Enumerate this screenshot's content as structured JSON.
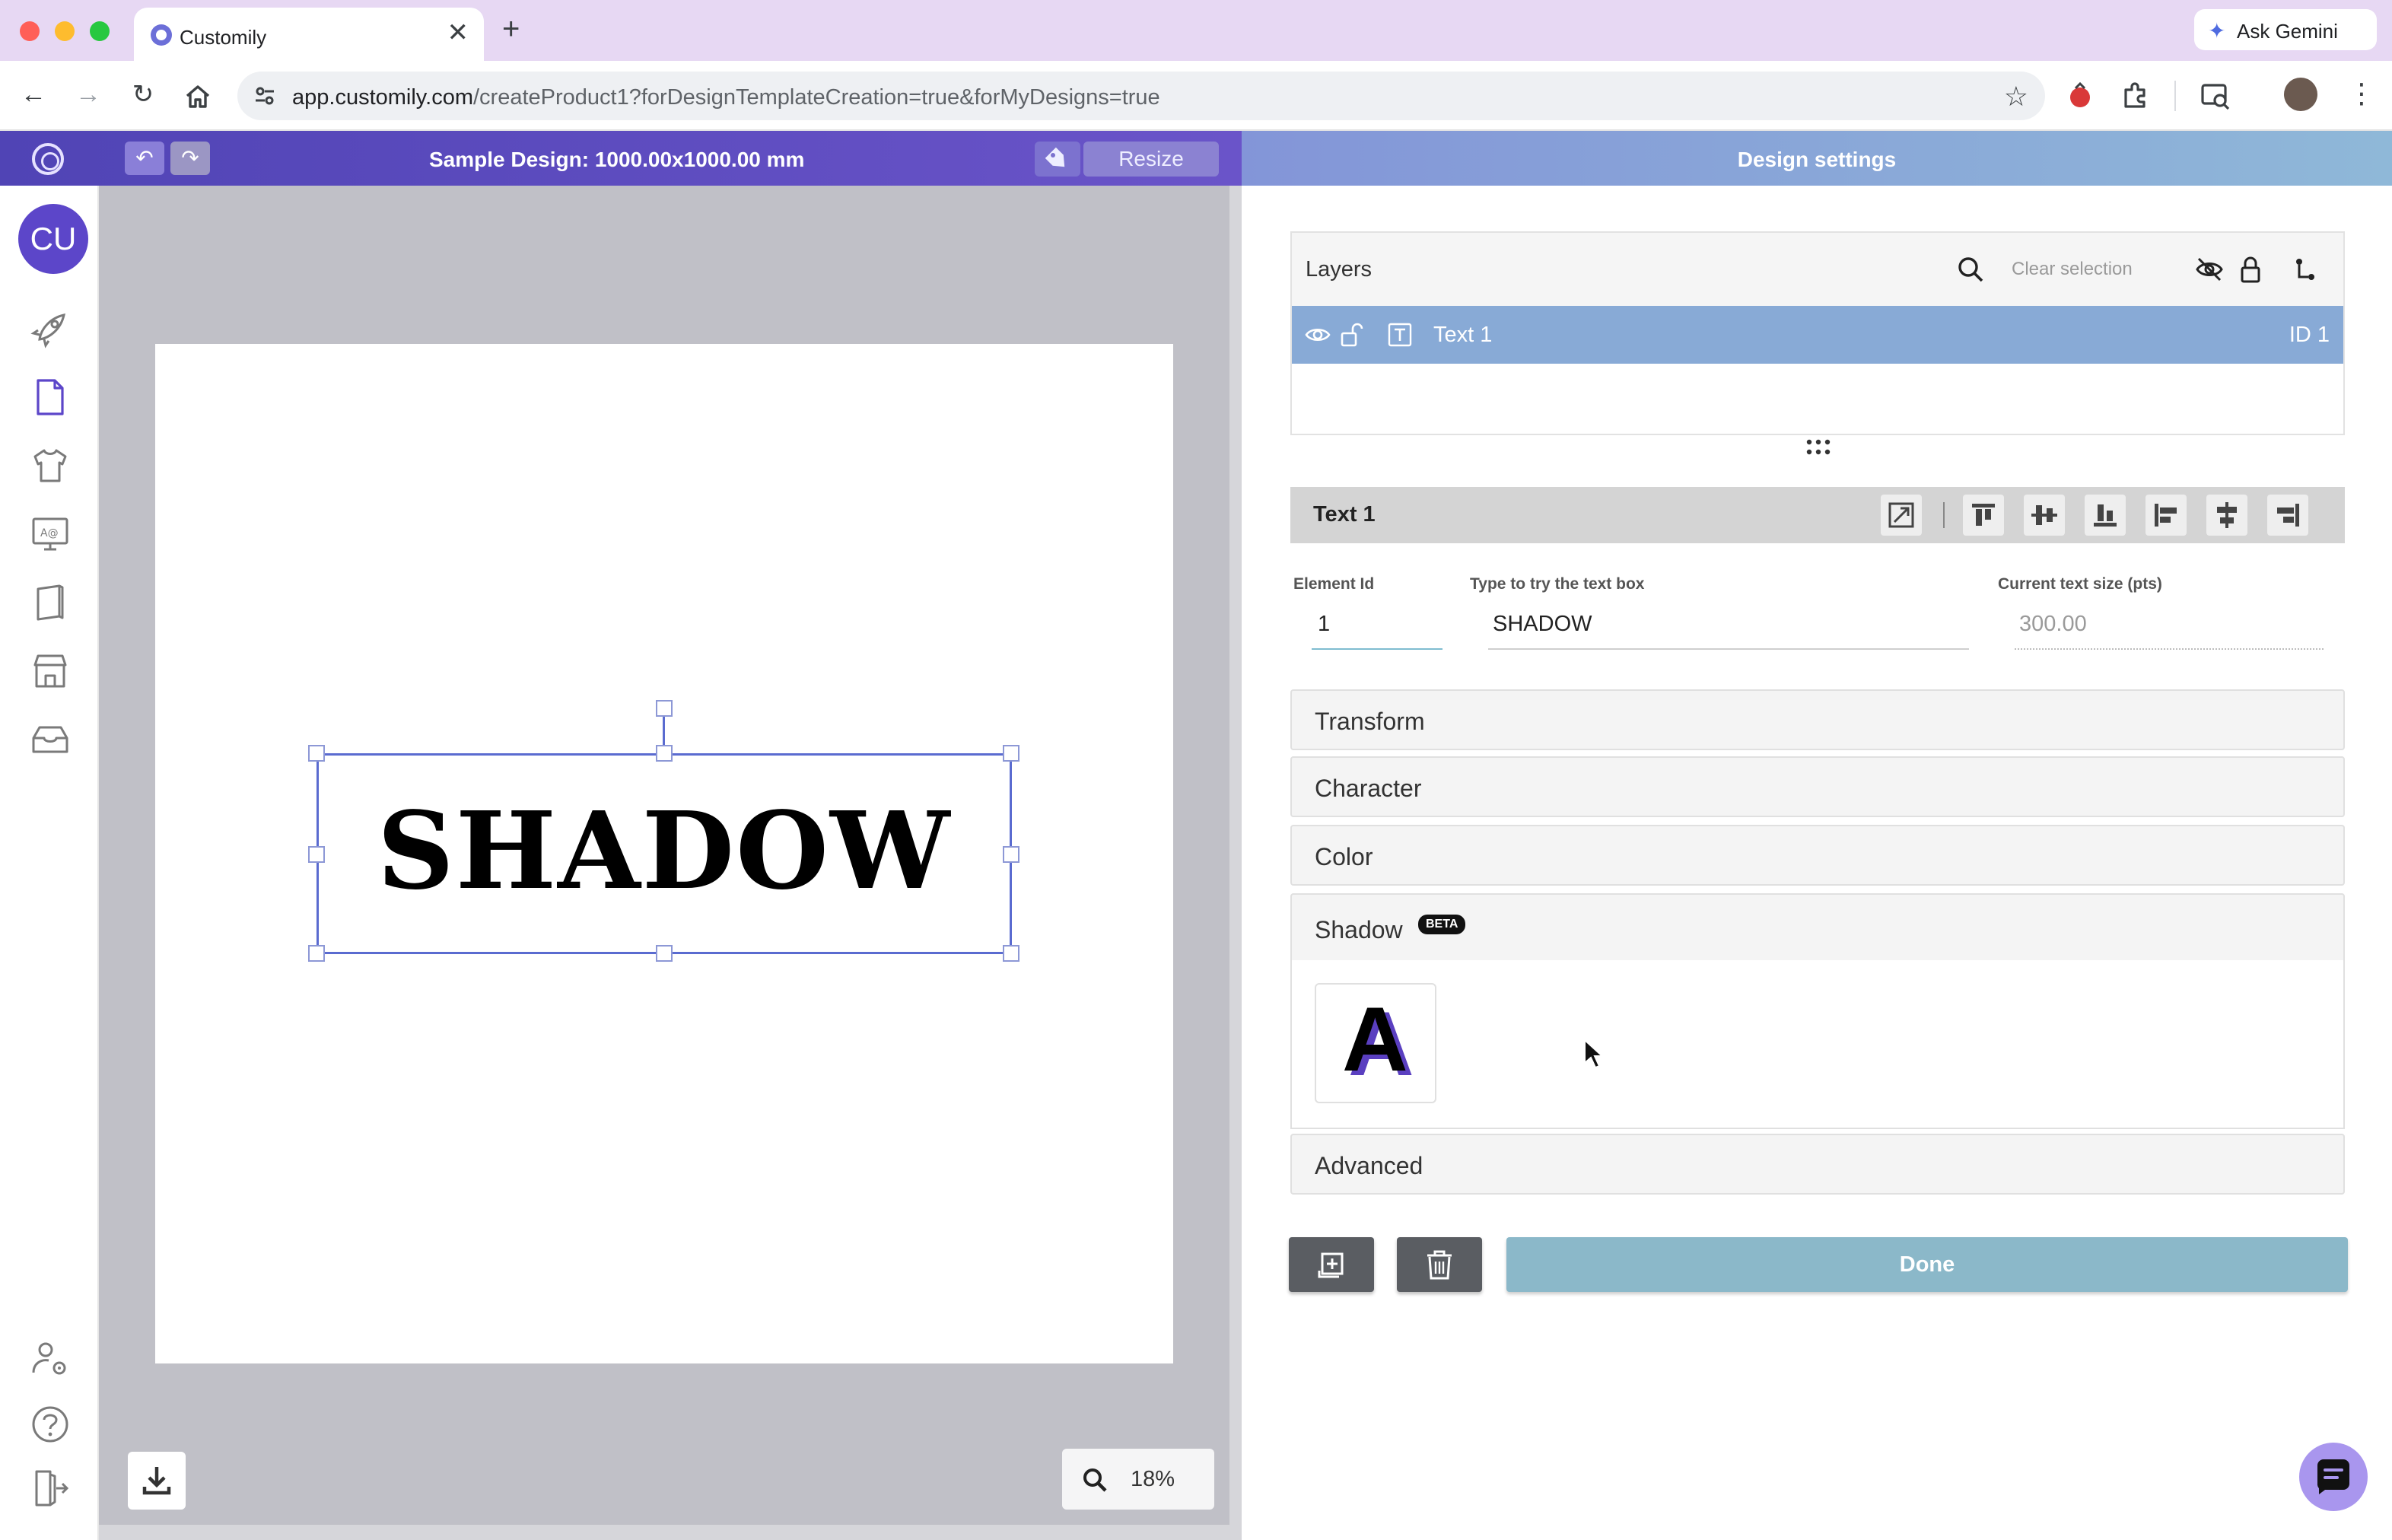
{
  "browser": {
    "tab_title": "Customily",
    "tab_close": "✕",
    "new_tab": "+",
    "url_host": "app.customily.com",
    "url_path": "/createProduct1?forDesignTemplateCreation=true&forMyDesigns=true",
    "ask_gemini": "Ask Gemini",
    "traffic_colors": [
      "#ff5f57",
      "#febc2e",
      "#28c840"
    ]
  },
  "header": {
    "design_title": "Sample Design: 1000.00x1000.00 mm",
    "resize_label": "Resize",
    "settings_title": "Design settings",
    "undo_glyph": "↶",
    "redo_glyph": "↷"
  },
  "sidebar": {
    "avatar_initials": "CU",
    "items": [
      {
        "icon": "rocket-icon"
      },
      {
        "icon": "document-icon"
      },
      {
        "icon": "tshirt-icon"
      },
      {
        "icon": "monitor-icon"
      },
      {
        "icon": "book-icon"
      },
      {
        "icon": "store-icon"
      },
      {
        "icon": "inbox-icon"
      }
    ],
    "bottom_items": [
      {
        "icon": "user-settings-icon"
      },
      {
        "icon": "help-icon"
      },
      {
        "icon": "logout-icon"
      }
    ]
  },
  "canvas": {
    "text_content": "SHADOW",
    "zoom": "18%"
  },
  "layers": {
    "title": "Layers",
    "clear_selection": "Clear selection",
    "rows": [
      {
        "name": "Text 1",
        "id_label": "ID 1"
      }
    ]
  },
  "element": {
    "name": "Text 1",
    "fields": {
      "element_id_label": "Element Id",
      "element_id_value": "1",
      "text_label": "Type to try the text box",
      "text_value": "SHADOW",
      "size_label": "Current text size (pts)",
      "size_value": "300.00"
    }
  },
  "accordions": {
    "transform": "Transform",
    "character": "Character",
    "color": "Color",
    "shadow": "Shadow",
    "shadow_badge": "BETA",
    "shadow_preset_glyph": "A",
    "advanced": "Advanced"
  },
  "actions": {
    "done_label": "Done"
  },
  "colors": {
    "accent_purple": "#5c46c9",
    "layer_selected": "#88aad6",
    "done_button": "#8bb8c9"
  }
}
